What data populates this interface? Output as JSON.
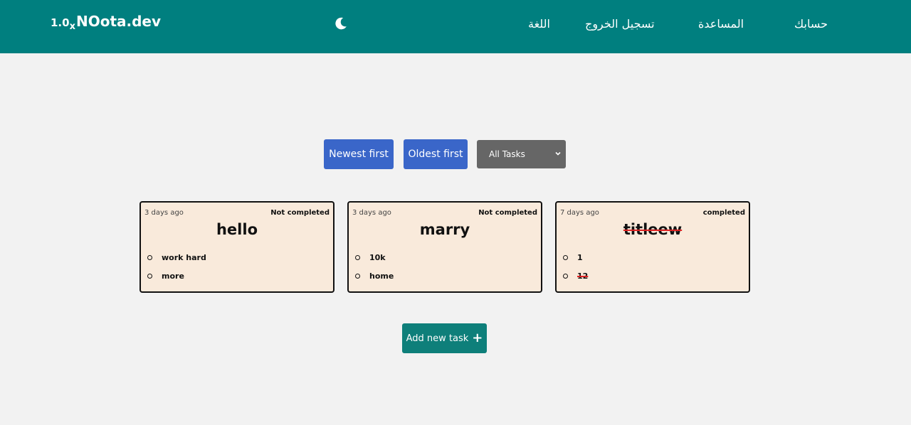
{
  "nav": {
    "brand": "NOota.dev",
    "version": "1.0",
    "version_suffix": "x",
    "theme_icon": "moon-icon",
    "links": {
      "language": "اللغة",
      "logout": "تسجيل الخروج",
      "help": "المساعدة",
      "account": "حسابك"
    }
  },
  "controls": {
    "newest": "Newest first",
    "oldest": "Oldest first",
    "filter_selected": "All Tasks"
  },
  "cards": [
    {
      "age": "3 days ago",
      "status": "Not completed",
      "title": "hello",
      "items": [
        "work hard",
        "more"
      ]
    },
    {
      "age": "3 days ago",
      "status": "Not completed",
      "title": "marry",
      "items": [
        "10k",
        "home"
      ]
    },
    {
      "age": "7 days ago",
      "status": "completed",
      "title": "titleew",
      "items": [
        "1",
        "12"
      ]
    }
  ],
  "add_button": {
    "label": "Add new task",
    "icon": "plus-icon"
  },
  "colors": {
    "navbar": "#007f7f",
    "button_blue": "#3a66c9",
    "select_gray": "#666666",
    "card_bg": "#f9eadb",
    "add_button": "#0e7f7a",
    "strike": "#dd2222"
  }
}
